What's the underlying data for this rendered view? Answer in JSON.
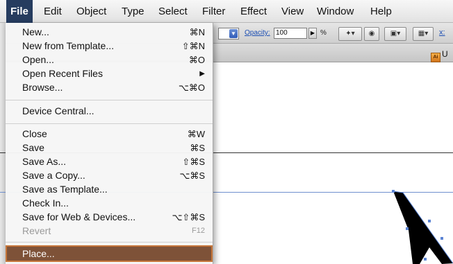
{
  "menubar": {
    "items": [
      "File",
      "Edit",
      "Object",
      "Type",
      "Select",
      "Filter",
      "Effect",
      "View",
      "Window",
      "Help"
    ],
    "active_index": 0
  },
  "controlbar": {
    "opacity_label": "Opacity:",
    "opacity_value": "100",
    "percent": "%",
    "x_label": "x:"
  },
  "document_tab": {
    "label": "U",
    "icon": "illustrator-file-icon",
    "icon_text": "Ai"
  },
  "file_menu": {
    "new": {
      "label": "New...",
      "shortcut": "⌘N"
    },
    "new_from_template": {
      "label": "New from Template...",
      "shortcut": "⇧⌘N"
    },
    "open": {
      "label": "Open...",
      "shortcut": "⌘O"
    },
    "open_recent": {
      "label": "Open Recent Files",
      "submenu_arrow": "▶"
    },
    "browse": {
      "label": "Browse...",
      "shortcut": "⌥⌘O"
    },
    "device_central": {
      "label": "Device Central..."
    },
    "close": {
      "label": "Close",
      "shortcut": "⌘W"
    },
    "save": {
      "label": "Save",
      "shortcut": "⌘S"
    },
    "save_as": {
      "label": "Save As...",
      "shortcut": "⇧⌘S"
    },
    "save_copy": {
      "label": "Save a Copy...",
      "shortcut": "⌥⌘S"
    },
    "save_template": {
      "label": "Save as Template..."
    },
    "check_in": {
      "label": "Check In..."
    },
    "save_web": {
      "label": "Save for Web & Devices...",
      "shortcut": "⌥⇧⌘S"
    },
    "revert": {
      "label": "Revert",
      "shortcut": "F12"
    },
    "place": {
      "label": "Place..."
    }
  },
  "colors": {
    "menu_active": "#263c5f",
    "highlight_bg": "#7e5238",
    "highlight_border": "#c6763a",
    "guide_line": "#6f8fcf"
  }
}
